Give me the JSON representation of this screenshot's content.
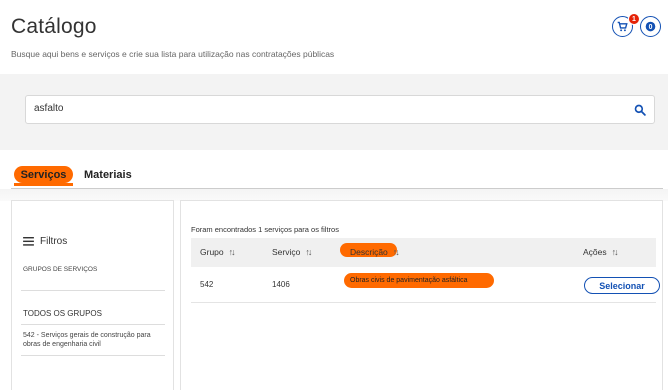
{
  "header": {
    "title": "Catálogo",
    "subtitle": "Busque aqui bens e serviços e crie sua lista para utilização nas contratações públicas",
    "cart_count": "1",
    "info_label": "0"
  },
  "search": {
    "value": "asfalto"
  },
  "tabs": [
    {
      "label": "Serviços",
      "active": true
    },
    {
      "label": "Materiais",
      "active": false
    }
  ],
  "filters": {
    "title": "Filtros",
    "group_heading": "GRUPOS DE SERVIÇOS",
    "all_groups": "TODOS OS GRUPOS",
    "group_item": "542 - Serviços gerais de construção para obras de engenharia civil"
  },
  "results": {
    "found_text": "Foram encontrados 1 serviços para os filtros",
    "columns": [
      "Grupo",
      "Serviço",
      "Descrição",
      "Ações"
    ],
    "rows": [
      {
        "grupo": "542",
        "servico": "1406",
        "descricao": "Obras civis de pavimentação asfáltica",
        "acao": "Selecionar"
      }
    ]
  },
  "colors": {
    "accent": "#ff6a00",
    "primary": "#1351b4",
    "badge": "#e52207"
  }
}
